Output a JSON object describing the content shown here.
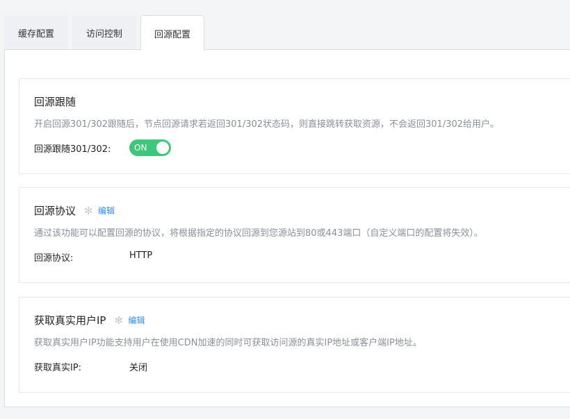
{
  "tabs": [
    {
      "label": "缓存配置"
    },
    {
      "label": "访问控制"
    },
    {
      "label": "回源配置"
    }
  ],
  "active_tab": "回源配置",
  "cards": {
    "follow": {
      "title": "回源跟随",
      "desc": "开启回源301/302跟随后，节点回源请求若返回301/302状态码，则直接跳转获取资源，不会返回301/302给用户。",
      "label": "回源跟随301/302:",
      "toggle_text": "ON",
      "toggle_on": true
    },
    "protocol": {
      "title": "回源协议",
      "edit": "编辑",
      "gear_icon": "gear-icon",
      "desc": "通过该功能可以配置回源的协议，将根据指定的协议回源到您源站到80或443端口（自定义端口的配置将失效）。",
      "label": "回源协议:",
      "value": "HTTP"
    },
    "realip": {
      "title": "获取真实用户IP",
      "edit": "编辑",
      "gear_icon": "gear-icon",
      "desc": "获取真实用户IP功能支持用户在使用CDN加速的同时可获取访问源的真实IP地址或客户端IP地址。",
      "label": "获取真实IP:",
      "value": "关闭"
    }
  },
  "colors": {
    "accent": "#2d8cf0",
    "toggle_on": "#3ec67a"
  }
}
